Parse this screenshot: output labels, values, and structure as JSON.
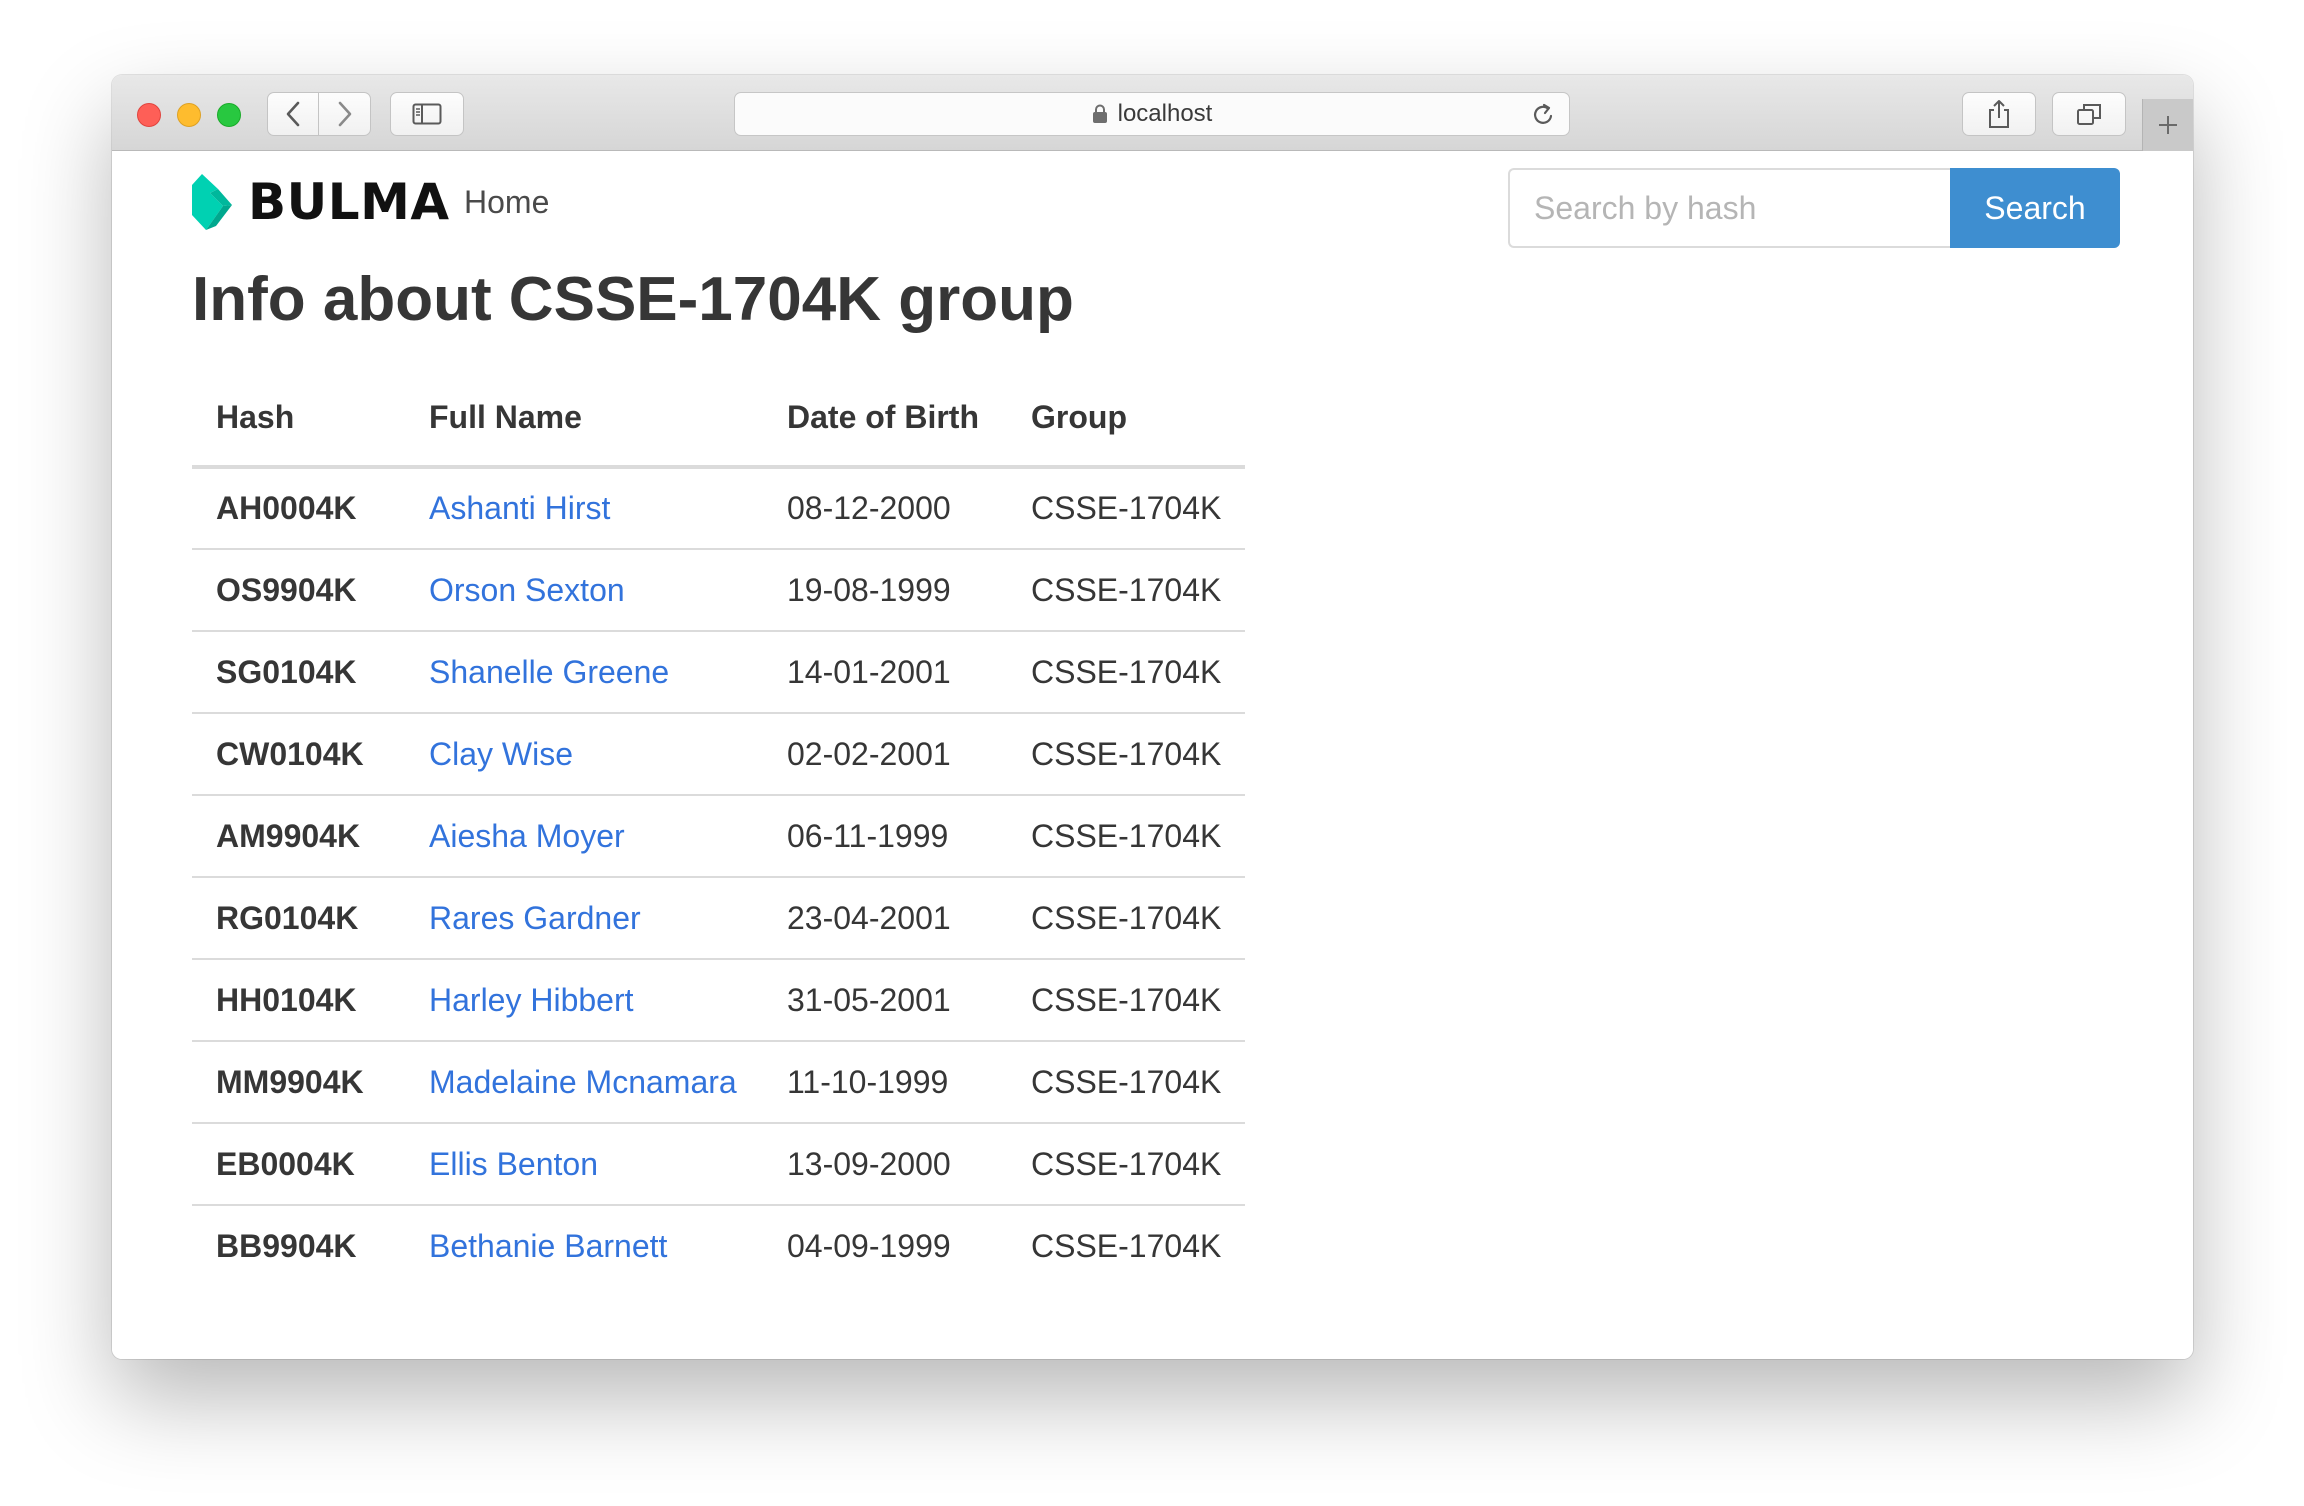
{
  "browser": {
    "url": "localhost",
    "icons": {
      "back": "chevron-left-icon",
      "forward": "chevron-right-icon",
      "sidebar": "sidebar-icon",
      "lock": "lock-icon",
      "reload": "reload-icon",
      "share": "share-icon",
      "tabs": "tabs-overview-icon",
      "add_tab": "plus-icon"
    }
  },
  "navbar": {
    "brand": "BULMA",
    "brand_color": "#00d1b2",
    "home_label": "Home",
    "search": {
      "placeholder": "Search by hash",
      "button_label": "Search",
      "button_color": "#3e8ed0"
    }
  },
  "page": {
    "title": "Info about CSSE-1704K group"
  },
  "table": {
    "headers": [
      "Hash",
      "Full Name",
      "Date of Birth",
      "Group"
    ],
    "link_color": "#3273dc",
    "rows": [
      {
        "hash": "AH0004K",
        "name": "Ashanti Hirst",
        "dob": "08-12-2000",
        "group": "CSSE-1704K"
      },
      {
        "hash": "OS9904K",
        "name": "Orson Sexton",
        "dob": "19-08-1999",
        "group": "CSSE-1704K"
      },
      {
        "hash": "SG0104K",
        "name": "Shanelle Greene",
        "dob": "14-01-2001",
        "group": "CSSE-1704K"
      },
      {
        "hash": "CW0104K",
        "name": "Clay Wise",
        "dob": "02-02-2001",
        "group": "CSSE-1704K"
      },
      {
        "hash": "AM9904K",
        "name": "Aiesha Moyer",
        "dob": "06-11-1999",
        "group": "CSSE-1704K"
      },
      {
        "hash": "RG0104K",
        "name": "Rares Gardner",
        "dob": "23-04-2001",
        "group": "CSSE-1704K"
      },
      {
        "hash": "HH0104K",
        "name": "Harley Hibbert",
        "dob": "31-05-2001",
        "group": "CSSE-1704K"
      },
      {
        "hash": "MM9904K",
        "name": "Madelaine Mcnamara",
        "dob": "11-10-1999",
        "group": "CSSE-1704K"
      },
      {
        "hash": "EB0004K",
        "name": "Ellis Benton",
        "dob": "13-09-2000",
        "group": "CSSE-1704K"
      },
      {
        "hash": "BB9904K",
        "name": "Bethanie Barnett",
        "dob": "04-09-1999",
        "group": "CSSE-1704K"
      }
    ]
  }
}
